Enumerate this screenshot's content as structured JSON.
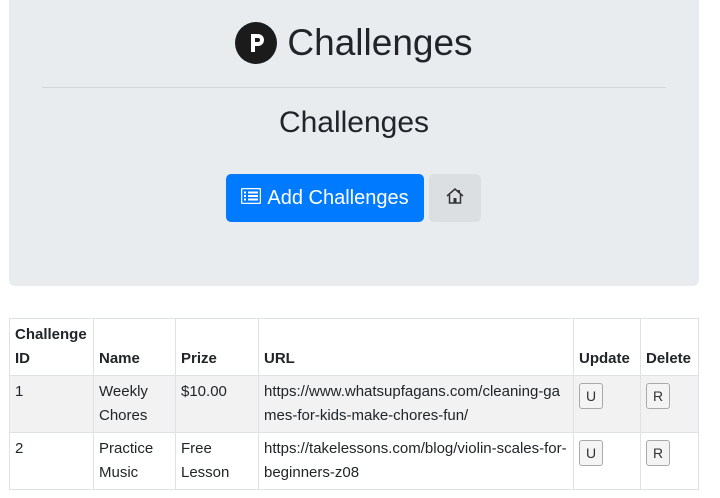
{
  "header": {
    "brand_title": "Challenges",
    "brand_icon": "p-logo-icon",
    "subtitle": "Challenges",
    "add_button_label": "Add Challenges",
    "add_button_icon": "list-icon",
    "home_button_icon": "home-icon"
  },
  "table": {
    "columns": [
      "Challenge ID",
      "Name",
      "Prize",
      "URL",
      "Update",
      "Delete"
    ],
    "rows": [
      {
        "id": "1",
        "name": "Weekly Chores",
        "prize": "$10.00",
        "url": "https://www.whatsupfagans.com/cleaning-games-for-kids-make-chores-fun/",
        "update_label": "U",
        "delete_label": "R"
      },
      {
        "id": "2",
        "name": "Practice Music",
        "prize": "Free Lesson",
        "url": "https://takelessons.com/blog/violin-scales-for-beginners-z08",
        "update_label": "U",
        "delete_label": "R"
      }
    ]
  },
  "colors": {
    "primary": "#007bff",
    "jumbotron": "#e9ecef",
    "home_button": "#dcdfe2"
  }
}
